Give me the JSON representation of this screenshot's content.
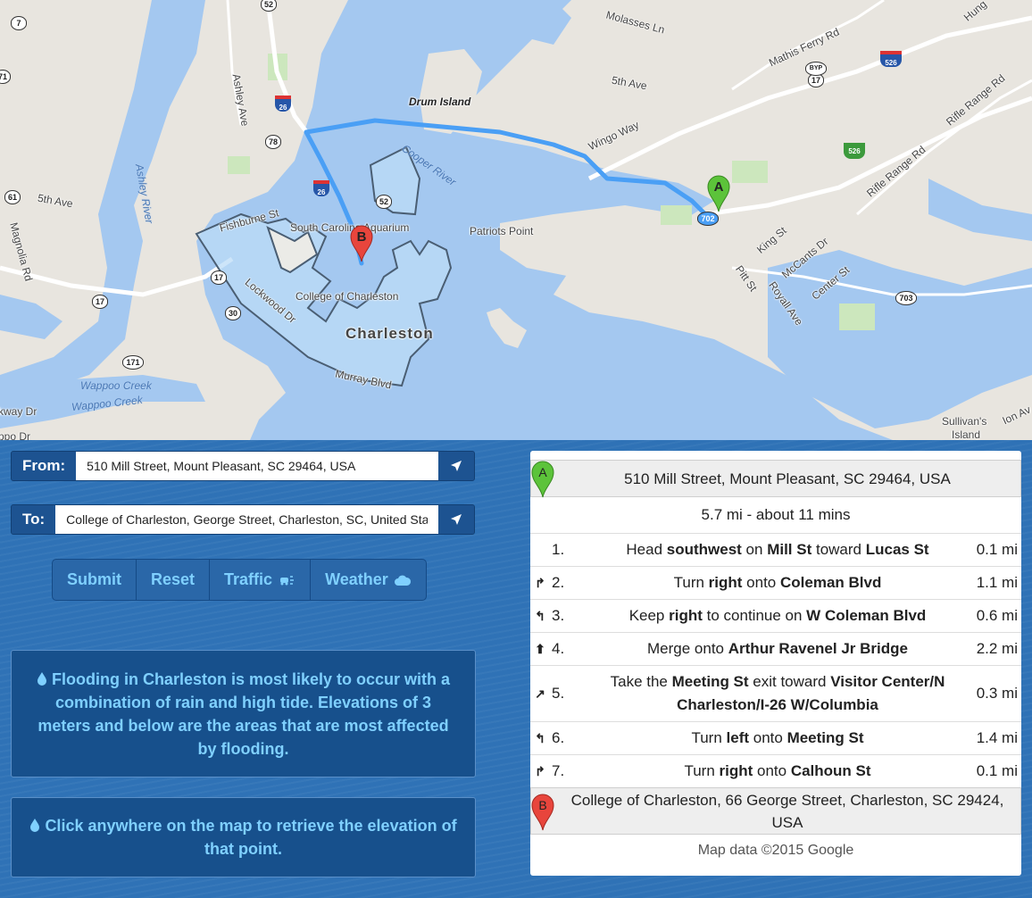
{
  "map": {
    "labels": {
      "drum_island": "Drum Island",
      "cooper_river": "Cooper River",
      "ashley_river": "Ashley River",
      "sc_aquarium": "South Carolina Aquarium",
      "patriots_point": "Patriots Point",
      "college": "College of Charleston",
      "charleston": "Charleston",
      "wappoo_creek_1": "Wappoo Creek",
      "wappoo_creek_2": "Wappoo Creek",
      "sullivans_island_1": "Sullivan's",
      "sullivans_island_2": "Island",
      "molasses_ln": "Molasses Ln",
      "mathis_ferry_rd": "Mathis Ferry Rd",
      "fifth_ave_east": "5th Ave",
      "fifth_ave_west": "5th Ave",
      "wingo_way": "Wingo Way",
      "rifle_range_rd_1": "Rifle Range Rd",
      "rifle_range_rd_2": "Rifle Range Rd",
      "ashley_ave": "Ashley Ave",
      "fishburne_st": "Fishburne St",
      "lockwood_dr": "Lockwood Dr",
      "murray_blvd": "Murray Blvd",
      "magnolia_rd": "Magnolia Rd",
      "king_st": "King St",
      "mccants_dr": "McCants Dr",
      "pitt_st": "Pitt St",
      "royall_ave": "Royall Ave",
      "center_st": "Center St",
      "hung": "Hung",
      "ion_av": "Ion Av",
      "kway_dr": "kway Dr",
      "ppo_dr": "ppo Dr"
    },
    "shields": {
      "r52": "52",
      "r7": "7",
      "r71": "71",
      "r78": "78",
      "r61": "61",
      "r17a": "17",
      "r17b": "17",
      "r17c": "17",
      "r30": "30",
      "r171": "171",
      "r703": "703",
      "i26a": "26",
      "i26b": "26",
      "i526a": "526",
      "i526b": "526",
      "byp": "BYP",
      "r52b": "52",
      "r702": "702"
    },
    "marker_a": "A",
    "marker_b": "B"
  },
  "form": {
    "from_label": "From:",
    "from_value": "510 Mill Street, Mount Pleasant, SC 29464, USA",
    "to_label": "To:",
    "to_value": "College of Charleston, George Street, Charleston, SC, United States"
  },
  "buttons": {
    "submit": "Submit",
    "reset": "Reset",
    "traffic": "Traffic",
    "weather": "Weather"
  },
  "info": {
    "flooding": "Flooding in Charleston is most likely to occur with a combination of rain and high tide. Elevations of 3 meters and below are the areas that are most affected by flooding.",
    "click_hint": "Click anywhere on the map to retrieve the elevation of that point."
  },
  "directions": {
    "start_marker": "A",
    "start_address": "510 Mill Street, Mount Pleasant, SC 29464, USA",
    "summary": "5.7 mi - about 11 mins",
    "steps": [
      {
        "num": "1.",
        "icon": "",
        "pre": "Head ",
        "b1": "southwest",
        "mid": " on ",
        "b2": "Mill St",
        "mid2": " toward ",
        "b3": "Lucas St",
        "dist": "0.1 mi"
      },
      {
        "num": "2.",
        "icon": "turn-right-icon",
        "pre": "Turn ",
        "b1": "right",
        "mid": " onto ",
        "b2": "Coleman Blvd",
        "mid2": "",
        "b3": "",
        "dist": "1.1 mi"
      },
      {
        "num": "3.",
        "icon": "keep-right-icon",
        "pre": "Keep ",
        "b1": "right",
        "mid": " to continue on ",
        "b2": "W Coleman Blvd",
        "mid2": "",
        "b3": "",
        "dist": "0.6 mi"
      },
      {
        "num": "4.",
        "icon": "merge-icon",
        "pre": "Merge onto ",
        "b1": "Arthur Ravenel Jr Bridge",
        "mid": "",
        "b2": "",
        "mid2": "",
        "b3": "",
        "dist": "2.2 mi"
      },
      {
        "num": "5.",
        "icon": "ramp-right-icon",
        "pre": "Take the ",
        "b1": "Meeting St",
        "mid": " exit toward ",
        "b2": "Visitor Center/N Charleston/I-26 W/Columbia",
        "mid2": "",
        "b3": "",
        "dist": "0.3 mi"
      },
      {
        "num": "6.",
        "icon": "turn-left-icon",
        "pre": "Turn ",
        "b1": "left",
        "mid": " onto ",
        "b2": "Meeting St",
        "mid2": "",
        "b3": "",
        "dist": "1.4 mi"
      },
      {
        "num": "7.",
        "icon": "turn-right-icon",
        "pre": "Turn ",
        "b1": "right",
        "mid": " onto ",
        "b2": "Calhoun St",
        "mid2": "",
        "b3": "",
        "dist": "0.1 mi"
      }
    ],
    "end_marker": "B",
    "end_address": "College of Charleston, 66 George Street, Charleston, SC 29424, USA",
    "copyright": "Map data ©2015 Google"
  },
  "colors": {
    "water": "#a4c8f0",
    "land": "#e8e5df",
    "route": "#4a9ff5",
    "flood_zone": "#bcdcf7",
    "panel_bg": "#2f72b6",
    "button_text": "#7fd0ff",
    "marker_a": "#5cc33a",
    "marker_b": "#e8453c"
  }
}
